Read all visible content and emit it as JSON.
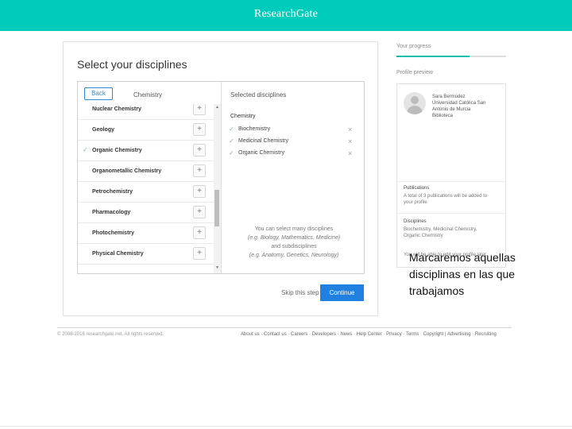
{
  "header": {
    "brand": "ResearchGate"
  },
  "main": {
    "title": "Select your disciplines",
    "back_label": "Back",
    "breadcrumb": "Chemistry",
    "selected_title": "Selected disciplines",
    "disciplines": [
      {
        "name": "Nuclear Chemistry",
        "checked": false
      },
      {
        "name": "Geology",
        "checked": false
      },
      {
        "name": "Organic Chemistry",
        "checked": true
      },
      {
        "name": "Organometallic Chemistry",
        "checked": false
      },
      {
        "name": "Petrochemistry",
        "checked": false
      },
      {
        "name": "Pharmacology",
        "checked": false
      },
      {
        "name": "Photochemistry",
        "checked": false
      },
      {
        "name": "Physical Chemistry",
        "checked": false
      }
    ],
    "add_glyph": "+",
    "check_glyph": "✓",
    "remove_glyph": "×",
    "selected_category": "Chemistry",
    "selected": [
      "Biochemistry",
      "Medicinal Chemistry",
      "Organic Chemistry"
    ],
    "hint": {
      "line1": "You can select many disciplines",
      "line2": "(e.g. Biology, Mathematics, Medicine)",
      "line3": "and subdisciplines",
      "line4": "(e.g. Anatomy, Genetics, Neurology)"
    },
    "skip_label": "Skip this step",
    "continue_label": "Continue"
  },
  "sidebar": {
    "progress_label": "Your progress",
    "progress_fraction": 0.67,
    "preview_label": "Profile preview",
    "profile": {
      "name": "Sara Bermúdez",
      "line2": "Universidad Católica San",
      "line3": "Antonio de Murcia",
      "line4": "Biblioteca"
    },
    "publications_title": "Publications",
    "publications_line1": "A total of 3 publications will be added to",
    "publications_line2": "your profile",
    "disciplines_title": "Disciplines",
    "disciplines_line1": "Biochemistry, Medicinal Chemistry,",
    "disciplines_line2": "Organic Chemistry",
    "note": "You will be able to edit your profile later."
  },
  "annotation": "Marcaremos aquellas disciplinas en las que trabajamos",
  "footer": {
    "copyright": "© 2008-2016 researchgate.net. All rights reserved.",
    "links": "About us · Contact us · Careers · Developers · News · Help Center · Privacy · Terms · Copyright | Advertising · Recruiting"
  },
  "colors": {
    "brand": "#00ccbb",
    "accent": "#1f80e0"
  }
}
